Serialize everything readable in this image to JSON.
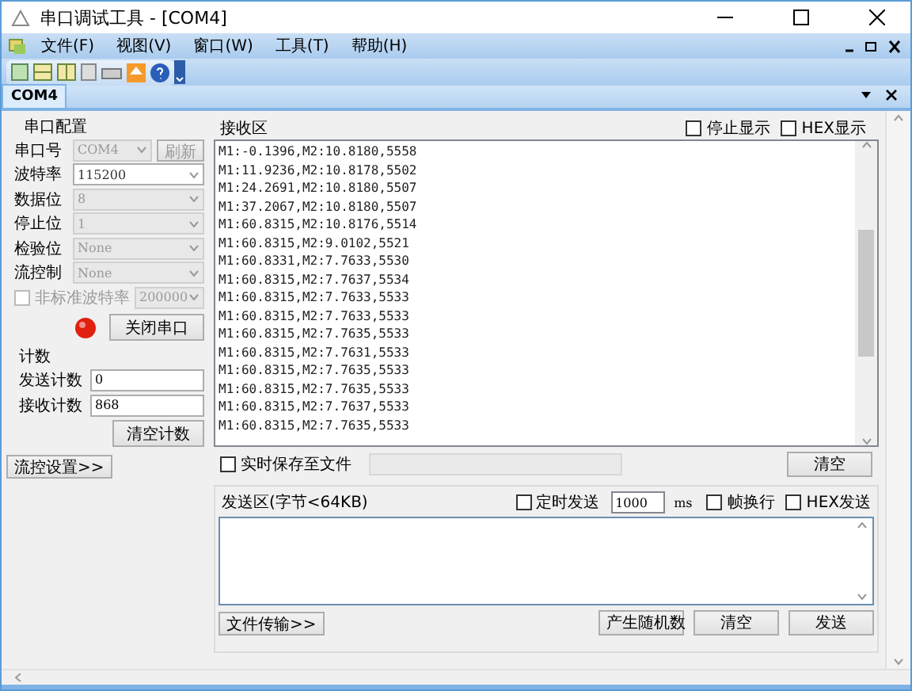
{
  "window": {
    "title": "串口调试工具 - [COM4]"
  },
  "menu": [
    "文件(F)",
    "视图(V)",
    "窗口(W)",
    "工具(T)",
    "帮助(H)"
  ],
  "tabs": [
    {
      "label": "COM4",
      "selected": true
    }
  ],
  "serial_config": {
    "title": "串口配置",
    "fields": [
      {
        "label": "串口号",
        "value": "COM4",
        "disabled": true,
        "button": "刷新"
      },
      {
        "label": "波特率",
        "value": "115200",
        "disabled": false
      },
      {
        "label": "数据位",
        "value": "8",
        "disabled": true
      },
      {
        "label": "停止位",
        "value": "1",
        "disabled": true
      },
      {
        "label": "检验位",
        "value": "None",
        "disabled": true
      },
      {
        "label": "流控制",
        "value": "None",
        "disabled": true
      }
    ],
    "custom_baud": {
      "label": "非标准波特率",
      "checked": false,
      "value": "200000",
      "disabled": true
    },
    "port_open": true,
    "port_button": "关闭串口"
  },
  "counters": {
    "title": "计数",
    "send_label": "发送计数",
    "send_value": "0",
    "recv_label": "接收计数",
    "recv_value": "868",
    "clear_button": "清空计数"
  },
  "flow_button": "流控设置>>",
  "receive": {
    "title": "接收区",
    "stop_display": {
      "label": "停止显示",
      "checked": false
    },
    "hex_display": {
      "label": "HEX显示",
      "checked": false
    },
    "lines": [
      "M1:-0.1396,M2:10.8180,5558",
      "M1:11.9236,M2:10.8178,5502",
      "M1:24.2691,M2:10.8180,5507",
      "M1:37.2067,M2:10.8180,5507",
      "M1:60.8315,M2:10.8176,5514",
      "M1:60.8315,M2:9.0102,5521",
      "M1:60.8331,M2:7.7633,5530",
      "M1:60.8315,M2:7.7637,5534",
      "M1:60.8315,M2:7.7633,5533",
      "M1:60.8315,M2:7.7633,5533",
      "M1:60.8315,M2:7.7635,5533",
      "M1:60.8315,M2:7.7631,5533",
      "M1:60.8315,M2:7.7635,5533",
      "M1:60.8315,M2:7.7635,5533",
      "M1:60.8315,M2:7.7637,5533",
      "M1:60.8315,M2:7.7635,5533"
    ],
    "save_to_file": {
      "label": "实时保存至文件",
      "checked": false
    },
    "clear_button": "清空"
  },
  "send": {
    "title": "发送区(字节<64KB)",
    "timed_send": {
      "label": "定时发送",
      "checked": false
    },
    "interval": "1000",
    "unit": "ms",
    "frame_newline": {
      "label": "帧换行",
      "checked": false
    },
    "hex_send": {
      "label": "HEX发送",
      "checked": false
    },
    "file_button": "文件传输>>",
    "buttons": [
      "产生随机数",
      "清空",
      "发送"
    ]
  }
}
